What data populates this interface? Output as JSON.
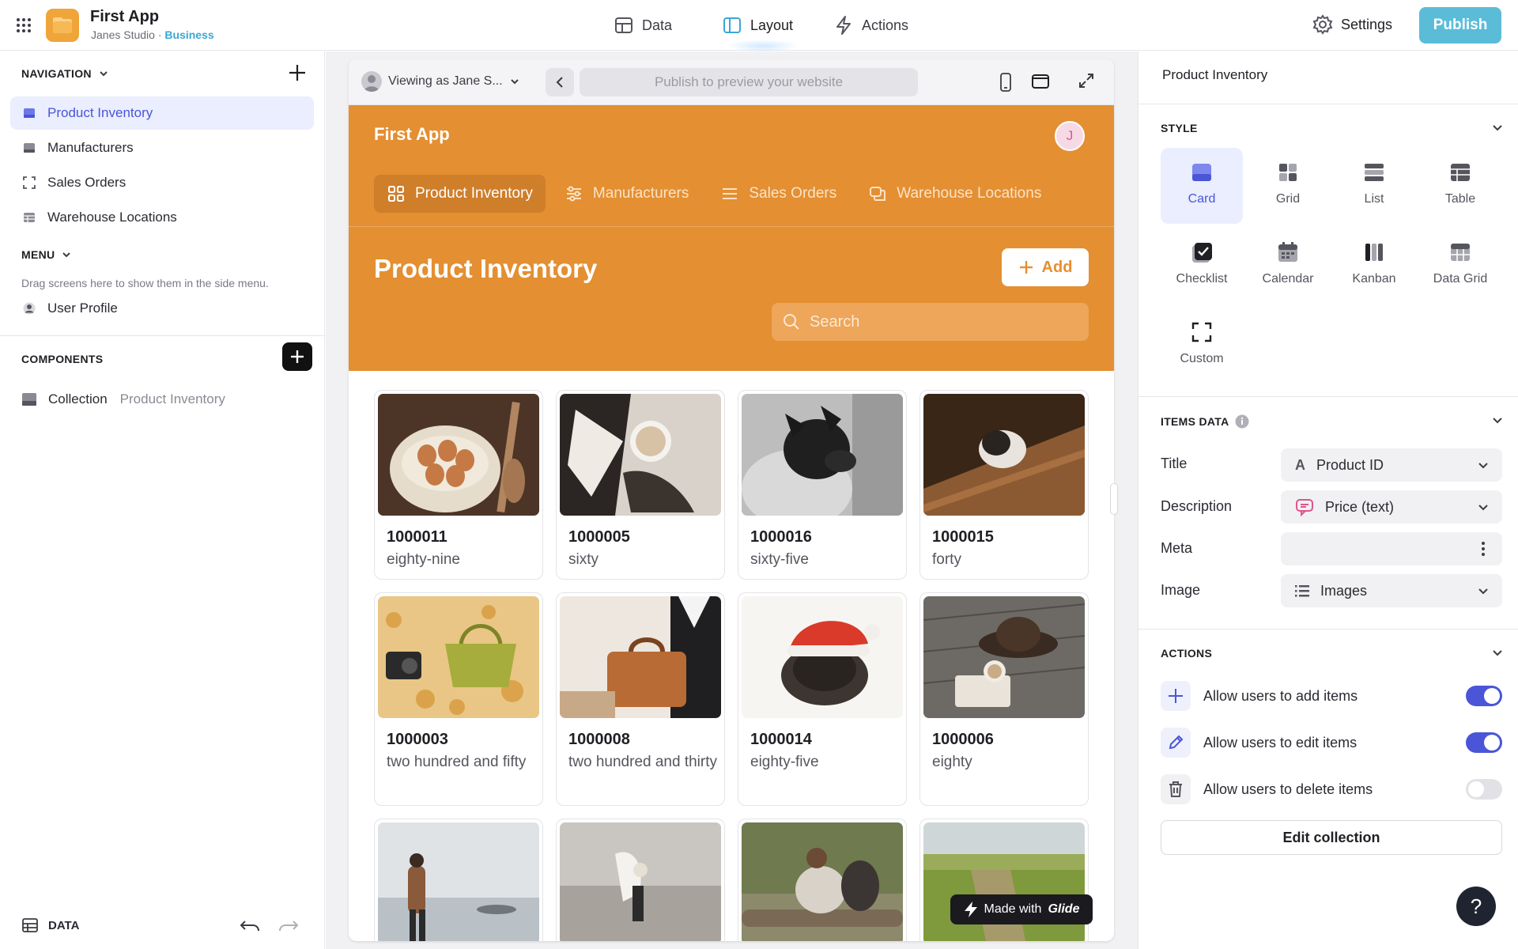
{
  "header": {
    "app_title": "First App",
    "studio": "Janes Studio",
    "separator": " · ",
    "plan": "Business",
    "nav": [
      {
        "label": "Data",
        "icon": "table-icon"
      },
      {
        "label": "Layout",
        "icon": "layout-icon"
      },
      {
        "label": "Actions",
        "icon": "bolt-icon"
      }
    ],
    "settings_label": "Settings",
    "publish_label": "Publish"
  },
  "sidebar": {
    "navigation_heading": "NAVIGATION",
    "nav_items": [
      {
        "label": "Product Inventory",
        "icon": "card-icon",
        "active": true
      },
      {
        "label": "Manufacturers",
        "icon": "card-icon"
      },
      {
        "label": "Sales Orders",
        "icon": "custom-icon"
      },
      {
        "label": "Warehouse Locations",
        "icon": "table-icon"
      }
    ],
    "menu_heading": "MENU",
    "menu_hint": "Drag screens here to show them in the side menu.",
    "menu_items": [
      {
        "label": "User Profile",
        "icon": "user-icon"
      }
    ],
    "components_heading": "COMPONENTS",
    "component": {
      "label": "Collection",
      "source": "Product Inventory"
    },
    "footer_label": "DATA"
  },
  "preview": {
    "viewing_as": "Viewing as Jane S...",
    "url_placeholder": "Publish to preview your website",
    "app_name": "First App",
    "avatar_letter": "J",
    "tabs": [
      {
        "label": "Product Inventory",
        "icon": "grid-icon",
        "active": true
      },
      {
        "label": "Manufacturers",
        "icon": "sliders-icon"
      },
      {
        "label": "Sales Orders",
        "icon": "list-icon"
      },
      {
        "label": "Warehouse Locations",
        "icon": "chat-icon"
      }
    ],
    "screen_title": "Product Inventory",
    "add_label": "Add",
    "search_placeholder": "Search",
    "cards": [
      {
        "title": "1000011",
        "description": "eighty-nine",
        "image": "eggs-in-bowl"
      },
      {
        "title": "1000005",
        "description": "sixty",
        "image": "coffee-cup"
      },
      {
        "title": "1000016",
        "description": "sixty-five",
        "image": "french-bulldog"
      },
      {
        "title": "1000015",
        "description": "forty",
        "image": "puppy-in-box"
      },
      {
        "title": "1000003",
        "description": "two hundred and fifty",
        "image": "bag-in-leaves"
      },
      {
        "title": "1000008",
        "description": "two hundred and thirty",
        "image": "leather-briefcase"
      },
      {
        "title": "1000014",
        "description": "eighty-five",
        "image": "dog-santa-hat"
      },
      {
        "title": "1000006",
        "description": "eighty",
        "image": "hat-on-table"
      },
      {
        "title": "",
        "description": "",
        "image": "hiker-by-lake"
      },
      {
        "title": "",
        "description": "",
        "image": "person-on-beach"
      },
      {
        "title": "",
        "description": "",
        "image": "men-on-log"
      },
      {
        "title": "",
        "description": "",
        "image": "grass-field"
      }
    ],
    "made_with": "Made with",
    "made_with_brand": "Glide"
  },
  "panel": {
    "title": "Product Inventory",
    "style_heading": "STYLE",
    "styles": [
      {
        "label": "Card",
        "active": true
      },
      {
        "label": "Grid"
      },
      {
        "label": "List"
      },
      {
        "label": "Table"
      },
      {
        "label": "Checklist"
      },
      {
        "label": "Calendar"
      },
      {
        "label": "Kanban"
      },
      {
        "label": "Data Grid"
      },
      {
        "label": "Custom"
      }
    ],
    "items_heading": "ITEMS DATA",
    "fields": [
      {
        "label": "Title",
        "value": "Product ID",
        "icon": "text-type-icon"
      },
      {
        "label": "Description",
        "value": "Price (text)",
        "icon": "speech-bubble-icon"
      },
      {
        "label": "Meta",
        "value": "",
        "icon": "more-vertical-icon"
      },
      {
        "label": "Image",
        "value": "Images",
        "icon": "list-icon"
      }
    ],
    "actions_heading": "ACTIONS",
    "actions": [
      {
        "label": "Allow users to add items",
        "enabled": true,
        "icon": "plus-icon"
      },
      {
        "label": "Allow users to edit items",
        "enabled": true,
        "icon": "pencil-icon"
      },
      {
        "label": "Allow users to delete items",
        "enabled": false,
        "icon": "trash-icon"
      }
    ],
    "edit_collection_label": "Edit collection",
    "help_label": "?"
  },
  "colors": {
    "accent": "#4a55d8",
    "app_primary": "#e48f32",
    "publish": "#5bbcd8"
  }
}
